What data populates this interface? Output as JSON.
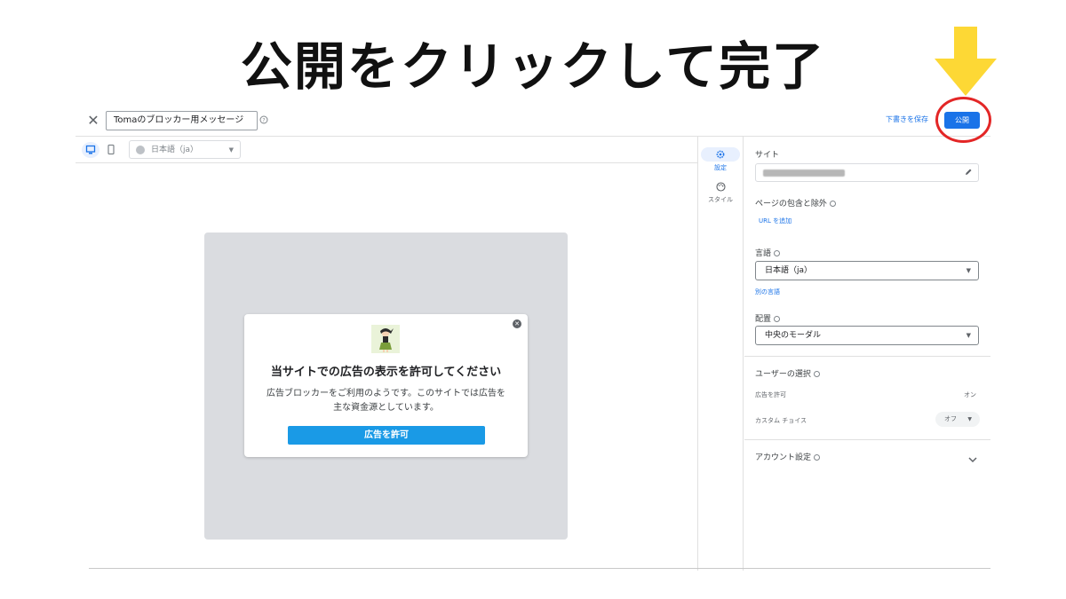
{
  "annotation": {
    "headline": "公開をクリックして完了",
    "arrow_color": "#fdd835",
    "circle_color": "#e32626"
  },
  "topbar": {
    "close_icon": "close-icon",
    "title_value": "Tomaのブロッカー用メッセージ",
    "save_draft_label": "下書きを保存",
    "publish_label": "公開"
  },
  "toolbar": {
    "desktop_icon": "desktop-icon",
    "mobile_icon": "mobile-icon",
    "language_value": "日本語（ja）"
  },
  "modal": {
    "title": "当サイトでの広告の表示を許可してください",
    "body_line1": "広告ブロッカーをご利用のようです。このサイトでは広告を",
    "body_line2": "主な資金源としています。",
    "allow_button": "広告を許可"
  },
  "rail": {
    "items": [
      {
        "label": "設定",
        "icon": "gear-icon"
      },
      {
        "label": "スタイル",
        "icon": "palette-icon"
      }
    ]
  },
  "panel": {
    "site_label": "サイト",
    "include_exclude_label": "ページの包含と除外",
    "add_url_link": "URL を追加",
    "language_label": "言語",
    "language_value": "日本語（ja）",
    "other_language_link": "別の言語",
    "placement_label": "配置",
    "placement_value": "中央のモーダル",
    "user_choice_label": "ユーザーの選択",
    "allow_ads_label": "広告を許可",
    "allow_ads_value": "オン",
    "custom_choice_label": "カスタム チョイス",
    "custom_choice_value": "オフ",
    "account_settings_label": "アカウント設定"
  },
  "colors": {
    "primary": "#1a73e8",
    "allow_button": "#1a9ae6",
    "preview_background": "#dadce0"
  }
}
